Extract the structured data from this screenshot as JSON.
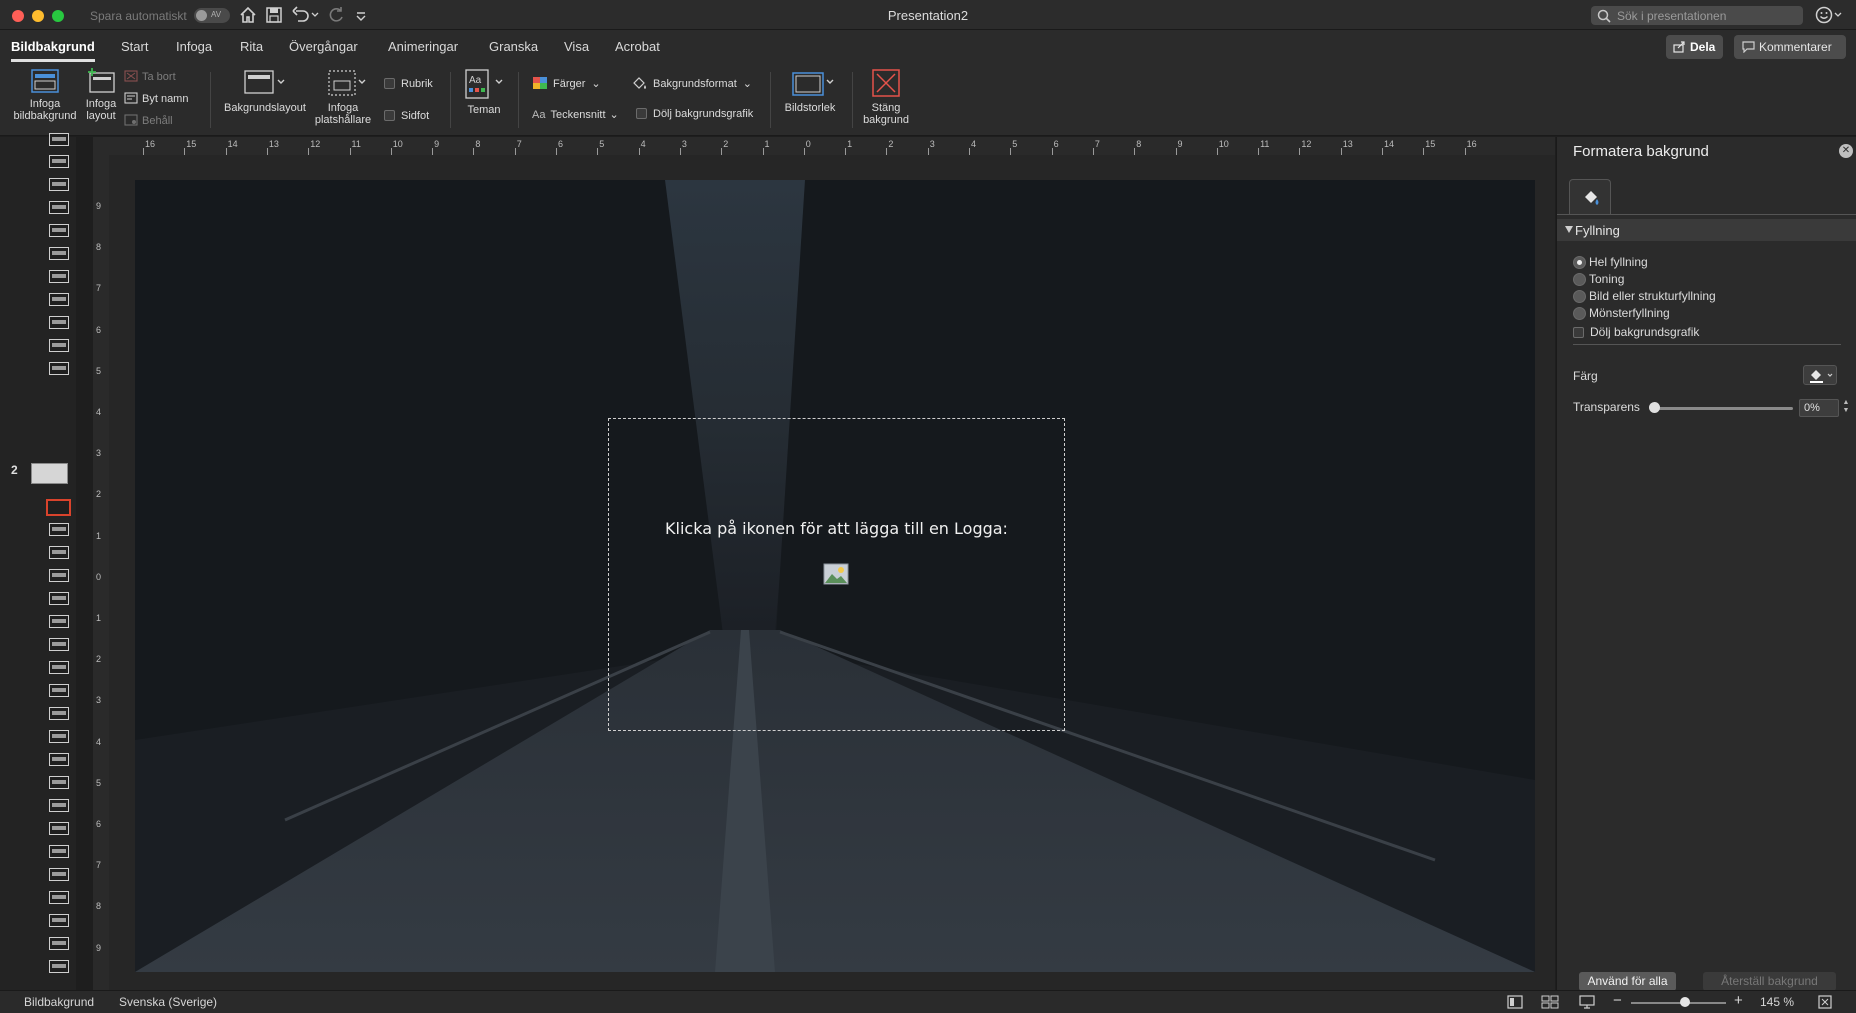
{
  "window": {
    "title": "Presentation2",
    "autosave_label": "Spara automatiskt",
    "autosave_state": "AV",
    "search_placeholder": "Sök i presentationen"
  },
  "tabs": [
    {
      "label": "Bildbakgrund",
      "active": true
    },
    {
      "label": "Start"
    },
    {
      "label": "Infoga"
    },
    {
      "label": "Rita"
    },
    {
      "label": "Övergångar"
    },
    {
      "label": "Animeringar"
    },
    {
      "label": "Granska"
    },
    {
      "label": "Visa"
    },
    {
      "label": "Acrobat"
    }
  ],
  "header_buttons": {
    "share": "Dela",
    "comments": "Kommentarer"
  },
  "ribbon": {
    "insert_master_line1": "Infoga",
    "insert_master_line2": "bildbakgrund",
    "insert_layout_line1": "Infoga",
    "insert_layout_line2": "layout",
    "delete": "Ta bort",
    "rename": "Byt namn",
    "preserve": "Behåll",
    "master_layout": "Bakgrundslayout",
    "insert_placeholder_line1": "Infoga",
    "insert_placeholder_line2": "platshållare",
    "title_chk": "Rubrik",
    "footer_chk": "Sidfot",
    "themes": "Teman",
    "colors": "Färger",
    "fonts": "Teckensnitt",
    "bg_styles": "Bakgrundsformat",
    "hide_bg_graphics": "Dölj bakgrundsgrafik",
    "slide_size": "Bildstorlek",
    "close_line1": "Stäng",
    "close_line2": "bakgrund"
  },
  "thumbnails": {
    "slide_number": "2"
  },
  "slide": {
    "placeholder_text": "Klicka på ikonen för att lägga till en Logga:"
  },
  "pane": {
    "title": "Formatera bakgrund",
    "section": "Fyllning",
    "options": [
      {
        "label": "Hel fyllning",
        "selected": true
      },
      {
        "label": "Toning",
        "selected": false
      },
      {
        "label": "Bild eller strukturfyllning",
        "selected": false
      },
      {
        "label": "Mönsterfyllning",
        "selected": false
      }
    ],
    "hide_graphics": "Dölj bakgrundsgrafik",
    "color_label": "Färg",
    "transparency_label": "Transparens",
    "transparency_value": "0%",
    "transparency_fraction": 0,
    "apply_all": "Använd för alla",
    "reset": "Återställ bakgrund"
  },
  "status": {
    "view": "Bildbakgrund",
    "language": "Svenska (Sverige)",
    "zoom": "145 %"
  },
  "ruler": {
    "h_labels": [
      "16",
      "15",
      "14",
      "13",
      "12",
      "11",
      "10",
      "9",
      "8",
      "7",
      "6",
      "5",
      "4",
      "3",
      "2",
      "1",
      "0",
      "1",
      "2",
      "3",
      "4",
      "5",
      "6",
      "7",
      "8",
      "9",
      "10",
      "11",
      "12",
      "13",
      "14",
      "15",
      "16"
    ],
    "v_labels": [
      "9",
      "8",
      "7",
      "6",
      "5",
      "4",
      "3",
      "2",
      "1",
      "0",
      "1",
      "2",
      "3",
      "4",
      "5",
      "6",
      "7",
      "8",
      "9"
    ]
  },
  "colors": {
    "accent_red": "#d9432c",
    "chrome_dark": "#2b2b2b"
  }
}
